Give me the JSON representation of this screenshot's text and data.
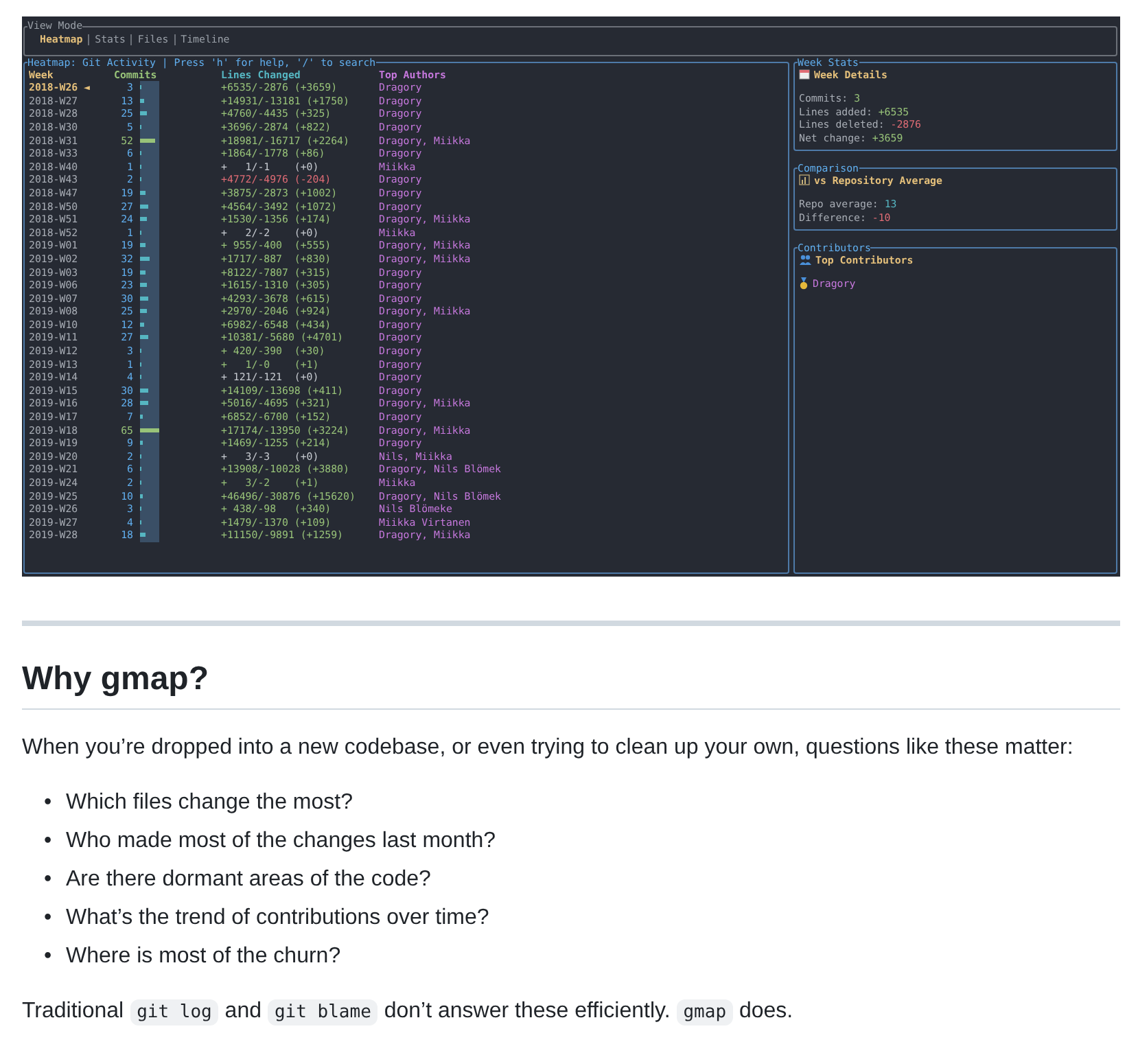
{
  "terminal": {
    "view_mode": {
      "title": "View Mode",
      "tabs": [
        {
          "label": "Heatmap",
          "selected": true
        },
        {
          "label": "Stats",
          "selected": false
        },
        {
          "label": "Files",
          "selected": false
        },
        {
          "label": "Timeline",
          "selected": false
        }
      ]
    },
    "heatmap": {
      "title": "Heatmap: Git Activity | Press 'h' for help, '/' to search",
      "columns": [
        "Week",
        "Commits",
        "Lines Changed",
        "Top Authors"
      ],
      "rows": [
        {
          "week": "2018-W26",
          "marker": "◄",
          "selected": true,
          "commits": "3",
          "level": 0.05,
          "lines": "+6535/-2876 (+3659)",
          "color": "#98c379",
          "authors": "Dragory"
        },
        {
          "week": "2018-W27",
          "selected": false,
          "commits": "13",
          "level": 0.2,
          "lines": "+14931/-13181 (+1750)",
          "color": "#98c379",
          "authors": "Dragory"
        },
        {
          "week": "2018-W28",
          "selected": false,
          "commits": "25",
          "level": 0.38,
          "lines": "+4760/-4435 (+325)",
          "color": "#98c379",
          "authors": "Dragory"
        },
        {
          "week": "2018-W30",
          "selected": false,
          "commits": "5",
          "level": 0.08,
          "lines": "+3696/-2874 (+822)",
          "color": "#98c379",
          "authors": "Dragory"
        },
        {
          "week": "2018-W31",
          "selected": false,
          "commits": "52",
          "level": 0.8,
          "lines": "+18981/-16717 (+2264)",
          "color": "#98c379",
          "authors": "Dragory, Miikka"
        },
        {
          "week": "2018-W33",
          "selected": false,
          "commits": "6",
          "level": 0.09,
          "lines": "+1864/-1778 (+86)",
          "color": "#98c379",
          "authors": "Dragory"
        },
        {
          "week": "2018-W40",
          "selected": false,
          "commits": "1",
          "level": 0.02,
          "lines": "+   1/-1    (+0)",
          "color": "#c8ccd2",
          "authors": "Miikka"
        },
        {
          "week": "2018-W43",
          "selected": false,
          "commits": "2",
          "level": 0.03,
          "lines": "+4772/-4976 (-204)",
          "color": "#e06c75",
          "authors": "Dragory"
        },
        {
          "week": "2018-W47",
          "selected": false,
          "commits": "19",
          "level": 0.29,
          "lines": "+3875/-2873 (+1002)",
          "color": "#98c379",
          "authors": "Dragory"
        },
        {
          "week": "2018-W50",
          "selected": false,
          "commits": "27",
          "level": 0.42,
          "lines": "+4564/-3492 (+1072)",
          "color": "#98c379",
          "authors": "Dragory"
        },
        {
          "week": "2018-W51",
          "selected": false,
          "commits": "24",
          "level": 0.37,
          "lines": "+1530/-1356 (+174)",
          "color": "#98c379",
          "authors": "Dragory, Miikka"
        },
        {
          "week": "2018-W52",
          "selected": false,
          "commits": "1",
          "level": 0.02,
          "lines": "+   2/-2    (+0)",
          "color": "#c8ccd2",
          "authors": "Miikka"
        },
        {
          "week": "2019-W01",
          "selected": false,
          "commits": "19",
          "level": 0.29,
          "lines": "+ 955/-400  (+555)",
          "color": "#98c379",
          "authors": "Dragory, Miikka"
        },
        {
          "week": "2019-W02",
          "selected": false,
          "commits": "32",
          "level": 0.49,
          "lines": "+1717/-887  (+830)",
          "color": "#98c379",
          "authors": "Dragory, Miikka"
        },
        {
          "week": "2019-W03",
          "selected": false,
          "commits": "19",
          "level": 0.29,
          "lines": "+8122/-7807 (+315)",
          "color": "#98c379",
          "authors": "Dragory"
        },
        {
          "week": "2019-W06",
          "selected": false,
          "commits": "23",
          "level": 0.35,
          "lines": "+1615/-1310 (+305)",
          "color": "#98c379",
          "authors": "Dragory"
        },
        {
          "week": "2019-W07",
          "selected": false,
          "commits": "30",
          "level": 0.46,
          "lines": "+4293/-3678 (+615)",
          "color": "#98c379",
          "authors": "Dragory"
        },
        {
          "week": "2019-W08",
          "selected": false,
          "commits": "25",
          "level": 0.38,
          "lines": "+2970/-2046 (+924)",
          "color": "#98c379",
          "authors": "Dragory, Miikka"
        },
        {
          "week": "2019-W10",
          "selected": false,
          "commits": "12",
          "level": 0.18,
          "lines": "+6982/-6548 (+434)",
          "color": "#98c379",
          "authors": "Dragory"
        },
        {
          "week": "2019-W11",
          "selected": false,
          "commits": "27",
          "level": 0.42,
          "lines": "+10381/-5680 (+4701)",
          "color": "#98c379",
          "authors": "Dragory"
        },
        {
          "week": "2019-W12",
          "selected": false,
          "commits": "3",
          "level": 0.05,
          "lines": "+ 420/-390  (+30)",
          "color": "#98c379",
          "authors": "Dragory"
        },
        {
          "week": "2019-W13",
          "selected": false,
          "commits": "1",
          "level": 0.02,
          "lines": "+   1/-0    (+1)",
          "color": "#98c379",
          "authors": "Dragory"
        },
        {
          "week": "2019-W14",
          "selected": false,
          "commits": "4",
          "level": 0.06,
          "lines": "+ 121/-121  (+0)",
          "color": "#c8ccd2",
          "authors": "Dragory"
        },
        {
          "week": "2019-W15",
          "selected": false,
          "commits": "30",
          "level": 0.46,
          "lines": "+14109/-13698 (+411)",
          "color": "#98c379",
          "authors": "Dragory"
        },
        {
          "week": "2019-W16",
          "selected": false,
          "commits": "28",
          "level": 0.43,
          "lines": "+5016/-4695 (+321)",
          "color": "#98c379",
          "authors": "Dragory, Miikka"
        },
        {
          "week": "2019-W17",
          "selected": false,
          "commits": "7",
          "level": 0.11,
          "lines": "+6852/-6700 (+152)",
          "color": "#98c379",
          "authors": "Dragory"
        },
        {
          "week": "2019-W18",
          "selected": false,
          "commits": "65",
          "level": 1,
          "lines": "+17174/-13950 (+3224)",
          "color": "#98c379",
          "authors": "Dragory, Miikka"
        },
        {
          "week": "2019-W19",
          "selected": false,
          "commits": "9",
          "level": 0.14,
          "lines": "+1469/-1255 (+214)",
          "color": "#98c379",
          "authors": "Dragory"
        },
        {
          "week": "2019-W20",
          "selected": false,
          "commits": "2",
          "level": 0.03,
          "lines": "+   3/-3    (+0)",
          "color": "#c8ccd2",
          "authors": "Nils, Miikka"
        },
        {
          "week": "2019-W21",
          "selected": false,
          "commits": "6",
          "level": 0.09,
          "lines": "+13908/-10028 (+3880)",
          "color": "#98c379",
          "authors": "Dragory, Nils Blömek"
        },
        {
          "week": "2019-W24",
          "selected": false,
          "commits": "2",
          "level": 0.03,
          "lines": "+   3/-2    (+1)",
          "color": "#98c379",
          "authors": "Miikka"
        },
        {
          "week": "2019-W25",
          "selected": false,
          "commits": "10",
          "level": 0.15,
          "lines": "+46496/-30876 (+15620)",
          "color": "#98c379",
          "authors": "Dragory, Nils Blömek"
        },
        {
          "week": "2019-W26",
          "selected": false,
          "commits": "3",
          "level": 0.05,
          "lines": "+ 438/-98   (+340)",
          "color": "#98c379",
          "authors": "Nils Blömeke"
        },
        {
          "week": "2019-W27",
          "selected": false,
          "commits": "4",
          "level": 0.06,
          "lines": "+1479/-1370 (+109)",
          "color": "#98c379",
          "authors": "Miikka Virtanen"
        },
        {
          "week": "2019-W28",
          "selected": false,
          "commits": "18",
          "level": 0.28,
          "lines": "+11150/-9891 (+1259)",
          "color": "#98c379",
          "authors": "Dragory, Miikka"
        }
      ]
    },
    "week_stats": {
      "title": "Week Stats",
      "heading": "Week Details",
      "items": [
        {
          "label": "Commits:",
          "value": "3",
          "color": "#98c379"
        },
        {
          "label": "Lines added:",
          "value": "+6535",
          "color": "#98c379"
        },
        {
          "label": "Lines deleted:",
          "value": "-2876",
          "color": "#e06c75"
        },
        {
          "label": "Net change:",
          "value": "+3659",
          "color": "#98c379"
        }
      ]
    },
    "comparison": {
      "title": "Comparison",
      "heading": "vs Repository Average",
      "items": [
        {
          "label": "Repo average:",
          "value": "13",
          "color": "#56b6c2"
        },
        {
          "label": "Difference:",
          "value": "-10",
          "color": "#e06c75"
        }
      ]
    },
    "contributors": {
      "title": "Contributors",
      "heading": "Top Contributors",
      "names": [
        "Dragory"
      ]
    }
  },
  "readme": {
    "heading": "Why gmap?",
    "intro": "When you’re dropped into a new codebase, or even trying to clean up your own, questions like these matter:",
    "questions": [
      {
        "marker": "•",
        "text": "Which files change the most?"
      },
      {
        "marker": "•",
        "text": "Who made most of the changes last month?"
      },
      {
        "marker": "•",
        "text": "Are there dormant areas of the code?"
      },
      {
        "marker": "•",
        "text": "What’s the trend of contributions over time?"
      },
      {
        "marker": "•",
        "text": "Where is most of the churn?"
      }
    ],
    "closing": [
      {
        "kind": "text",
        "text": "Traditional "
      },
      {
        "kind": "code",
        "text": "git log"
      },
      {
        "kind": "text",
        "text": " and "
      },
      {
        "kind": "code",
        "text": "git blame"
      },
      {
        "kind": "text",
        "text": " don’t answer these efficiently. "
      },
      {
        "kind": "code",
        "text": "gmap"
      },
      {
        "kind": "text",
        "text": " does."
      }
    ]
  }
}
